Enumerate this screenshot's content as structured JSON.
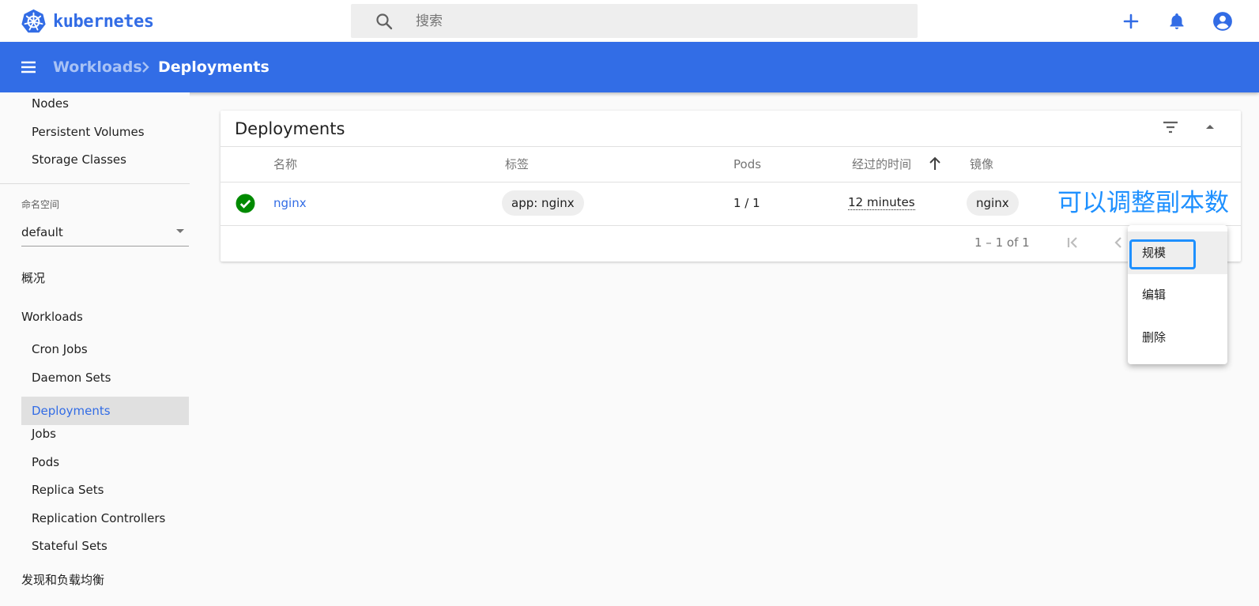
{
  "app": {
    "name": "kubernetes"
  },
  "search": {
    "placeholder": "搜索"
  },
  "header_icons": [
    "add-icon",
    "notifications-icon",
    "account-icon"
  ],
  "breadcrumb": {
    "parent": "Workloads",
    "current": "Deployments"
  },
  "sidebar": {
    "cluster_items": [
      "Nodes",
      "Persistent Volumes",
      "Storage Classes"
    ],
    "namespace_label": "命名空间",
    "namespace_value": "default",
    "overview": "概况",
    "workloads_title": "Workloads",
    "workload_items": [
      "Cron Jobs",
      "Daemon Sets",
      "Deployments",
      "Jobs",
      "Pods",
      "Replica Sets",
      "Replication Controllers",
      "Stateful Sets"
    ],
    "active_item": "Deployments",
    "discovery_title": "发现和负载均衡"
  },
  "card": {
    "title": "Deployments",
    "columns": [
      "名称",
      "标签",
      "Pods",
      "经过的时间",
      "镜像"
    ],
    "rows": [
      {
        "status": "success",
        "name": "nginx",
        "label": "app: nginx",
        "pods": "1 / 1",
        "age": "12 minutes",
        "image": "nginx"
      }
    ],
    "pagination": "1 – 1 of 1"
  },
  "annotation": "可以调整副本数",
  "context_menu": {
    "items": [
      "规模",
      "编辑",
      "删除"
    ],
    "highlighted": "规模"
  },
  "colors": {
    "primary": "#326ce5",
    "success": "#008a00",
    "annotation": "#1e90ff"
  }
}
